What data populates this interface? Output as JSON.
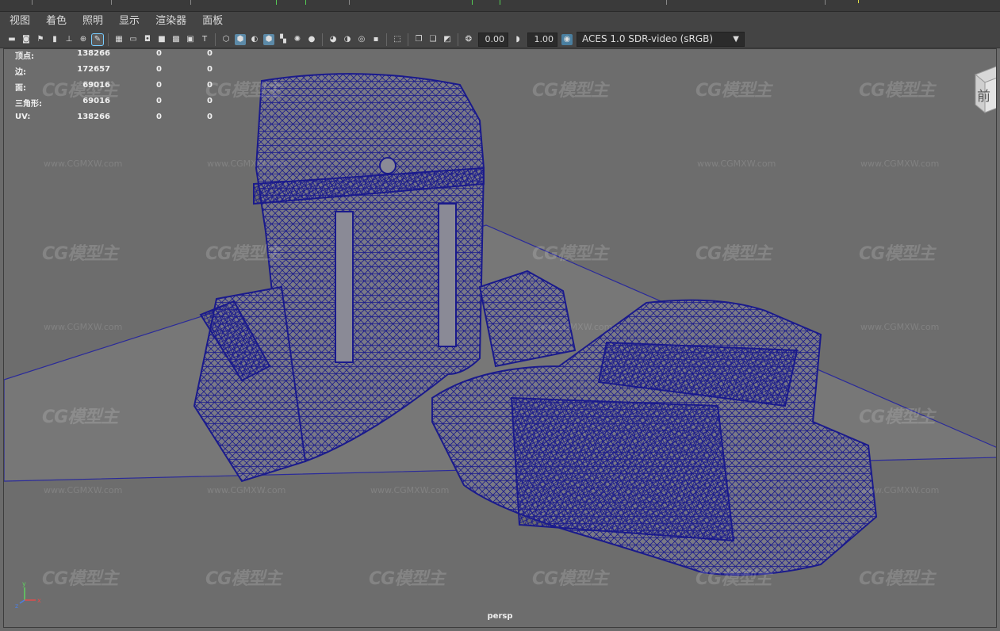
{
  "menubar": {
    "items": [
      "视图",
      "着色",
      "照明",
      "显示",
      "渲染器",
      "面板"
    ]
  },
  "toolbar": {
    "value_a": "0.00",
    "value_b": "1.00",
    "color_space": "ACES 1.0 SDR-video (sRGB)"
  },
  "hud": {
    "rows": [
      {
        "label": "顶点:",
        "v1": "138266",
        "v2": "0",
        "v3": "0"
      },
      {
        "label": "边:",
        "v1": "172657",
        "v2": "0",
        "v3": "0"
      },
      {
        "label": "面:",
        "v1": "69016",
        "v2": "0",
        "v3": "0"
      },
      {
        "label": "三角形:",
        "v1": "69016",
        "v2": "0",
        "v3": "0"
      },
      {
        "label": "UV:",
        "v1": "138266",
        "v2": "0",
        "v3": "0"
      }
    ]
  },
  "viewcube": {
    "face_label": "前"
  },
  "axis": {
    "x": "x",
    "y": "y",
    "z": "z"
  },
  "camera": {
    "name": "persp"
  },
  "watermark": {
    "logo": "CG模型主",
    "url": "www.CGMXW.com"
  },
  "colors": {
    "wireframe": "#1a1a8c",
    "grid_line": "#2a2a9a",
    "mesh_fill": "#7a7a86"
  }
}
